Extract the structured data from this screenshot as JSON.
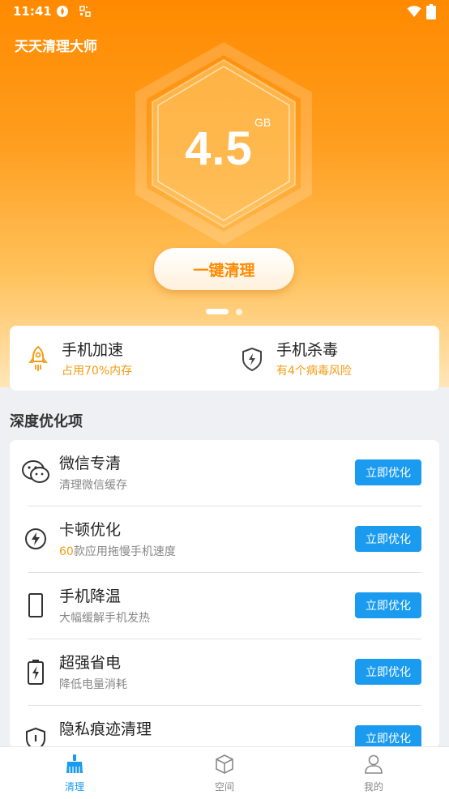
{
  "status_bar": {
    "time": "11:41"
  },
  "app": {
    "title": "天天清理大师"
  },
  "gauge": {
    "value": "4.5",
    "unit": "GB"
  },
  "clean_button": "一键清理",
  "carousel": {
    "pages": 2,
    "active": 1
  },
  "quick": [
    {
      "title": "手机加速",
      "subtitle": "占用70%内存",
      "icon": "rocket-icon"
    },
    {
      "title": "手机杀毒",
      "subtitle": "有4个病毒风险",
      "icon": "shield-icon"
    }
  ],
  "section": {
    "title": "深度优化项"
  },
  "optimize_items": [
    {
      "title": "微信专清",
      "subtitle": "清理微信缓存",
      "button": "立即优化",
      "icon": "wechat-icon"
    },
    {
      "title": "卡顿优化",
      "subtitle_highlight": "60",
      "subtitle": "款应用拖慢手机速度",
      "button": "立即优化",
      "icon": "lightning-icon"
    },
    {
      "title": "手机降温",
      "subtitle": "大幅缓解手机发热",
      "button": "立即优化",
      "icon": "phone-icon"
    },
    {
      "title": "超强省电",
      "subtitle": "降低电量消耗",
      "button": "立即优化",
      "icon": "battery-icon"
    },
    {
      "title": "隐私痕迹清理",
      "subtitle": "",
      "button": "立即优化",
      "icon": "privacy-shield-icon"
    }
  ],
  "tabs": [
    {
      "label": "清理",
      "icon": "broom-icon",
      "active": true
    },
    {
      "label": "空间",
      "icon": "box-icon",
      "active": false
    },
    {
      "label": "我的",
      "icon": "user-icon",
      "active": false
    }
  ],
  "colors": {
    "primary_orange": "#ff8a00",
    "accent_blue": "#1a9bf0",
    "warning_text": "#f29c11"
  }
}
